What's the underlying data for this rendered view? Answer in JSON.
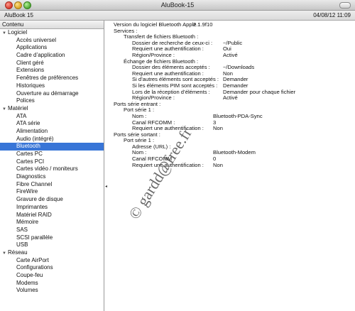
{
  "window": {
    "title": "AluBook-15"
  },
  "infobar": {
    "machine": "AluBook 15",
    "date": "04/08/12 11:09"
  },
  "sidebar": {
    "header": "Contenu",
    "rows": [
      {
        "label": "Logiciel",
        "type": "cat"
      },
      {
        "label": "Accès universel",
        "type": "item"
      },
      {
        "label": "Applications",
        "type": "item"
      },
      {
        "label": "Cadre d’application",
        "type": "item"
      },
      {
        "label": "Client géré",
        "type": "item"
      },
      {
        "label": "Extensions",
        "type": "item"
      },
      {
        "label": "Fenêtres de préférences",
        "type": "item"
      },
      {
        "label": "Historiques",
        "type": "item"
      },
      {
        "label": "Ouverture au démarrage",
        "type": "item"
      },
      {
        "label": "Polices",
        "type": "item"
      },
      {
        "label": "Matériel",
        "type": "cat"
      },
      {
        "label": "ATA",
        "type": "item"
      },
      {
        "label": "ATA série",
        "type": "item"
      },
      {
        "label": "Alimentation",
        "type": "item"
      },
      {
        "label": "Audio (intégré)",
        "type": "item"
      },
      {
        "label": "Bluetooth",
        "type": "item",
        "selected": true
      },
      {
        "label": "Cartes PC",
        "type": "item"
      },
      {
        "label": "Cartes PCI",
        "type": "item"
      },
      {
        "label": "Cartes vidéo / moniteurs",
        "type": "item"
      },
      {
        "label": "Diagnostics",
        "type": "item"
      },
      {
        "label": "Fibre Channel",
        "type": "item"
      },
      {
        "label": "FireWire",
        "type": "item"
      },
      {
        "label": "Gravure de disque",
        "type": "item"
      },
      {
        "label": "Imprimantes",
        "type": "item"
      },
      {
        "label": "Matériel RAID",
        "type": "item"
      },
      {
        "label": "Mémoire",
        "type": "item"
      },
      {
        "label": "SAS",
        "type": "item"
      },
      {
        "label": "SCSI parallèle",
        "type": "item"
      },
      {
        "label": "USB",
        "type": "item"
      },
      {
        "label": "Réseau",
        "type": "cat"
      },
      {
        "label": "Carte AirPort",
        "type": "item"
      },
      {
        "label": "Configurations",
        "type": "item"
      },
      {
        "label": "Coupe-feu",
        "type": "item"
      },
      {
        "label": "Modems",
        "type": "item"
      },
      {
        "label": "Volumes",
        "type": "item"
      }
    ]
  },
  "detail": {
    "lines": [
      {
        "indent": 0,
        "key": "Version du logiciel Bluetooth Apple :",
        "value": "2.1.9f10",
        "vcol": 1
      },
      {
        "indent": 0,
        "key": "Services :",
        "value": ""
      },
      {
        "indent": 1,
        "key": "Transfert de fichiers Bluetooth :",
        "value": ""
      },
      {
        "indent": 2,
        "key": "Dossier de recherche de ceux-ci :",
        "value": "~/Public"
      },
      {
        "indent": 2,
        "key": "Requiert une authentification :",
        "value": "Oui"
      },
      {
        "indent": 2,
        "key": "Région/Province :",
        "value": "Activé"
      },
      {
        "indent": 1,
        "key": "Échange de fichiers Bluetooth :",
        "value": ""
      },
      {
        "indent": 2,
        "key": "Dossier des éléments acceptés :",
        "value": "~/Downloads"
      },
      {
        "indent": 2,
        "key": "Requiert une authentification :",
        "value": "Non"
      },
      {
        "indent": 2,
        "key": "Si d’autres éléments sont acceptés :",
        "value": "Demander"
      },
      {
        "indent": 2,
        "key": "Si les éléments PIM sont acceptés :",
        "value": "Demander"
      },
      {
        "indent": 2,
        "key": "Lors de la réception d’éléments :",
        "value": "Demander pour chaque fichier"
      },
      {
        "indent": 2,
        "key": "Région/Province :",
        "value": "Activé"
      },
      {
        "indent": 0,
        "key": "Ports série entrant :",
        "value": ""
      },
      {
        "indent": 1,
        "key": "Port série 1 :",
        "value": ""
      },
      {
        "indent": 2,
        "key": "Nom :",
        "value": "Bluetooth-PDA-Sync",
        "vcol": 3
      },
      {
        "indent": 2,
        "key": "Canal RFCOMM :",
        "value": "3",
        "vcol": 3
      },
      {
        "indent": 2,
        "key": "Requiert une authentification :",
        "value": "Non",
        "vcol": 3
      },
      {
        "indent": 0,
        "key": "Ports série sortant :",
        "value": ""
      },
      {
        "indent": 1,
        "key": "Port série 1 :",
        "value": ""
      },
      {
        "indent": 2,
        "key": "Adresse (URL) :",
        "value": ""
      },
      {
        "indent": 2,
        "key": "Nom :",
        "value": "Bluetooth-Modem",
        "vcol": 3
      },
      {
        "indent": 2,
        "key": "Canal RFCOMM :",
        "value": "0",
        "vcol": 3
      },
      {
        "indent": 2,
        "key": "Requiert une authentification :",
        "value": "Non",
        "vcol": 3
      }
    ]
  },
  "watermark": "© gardd@free.fr"
}
